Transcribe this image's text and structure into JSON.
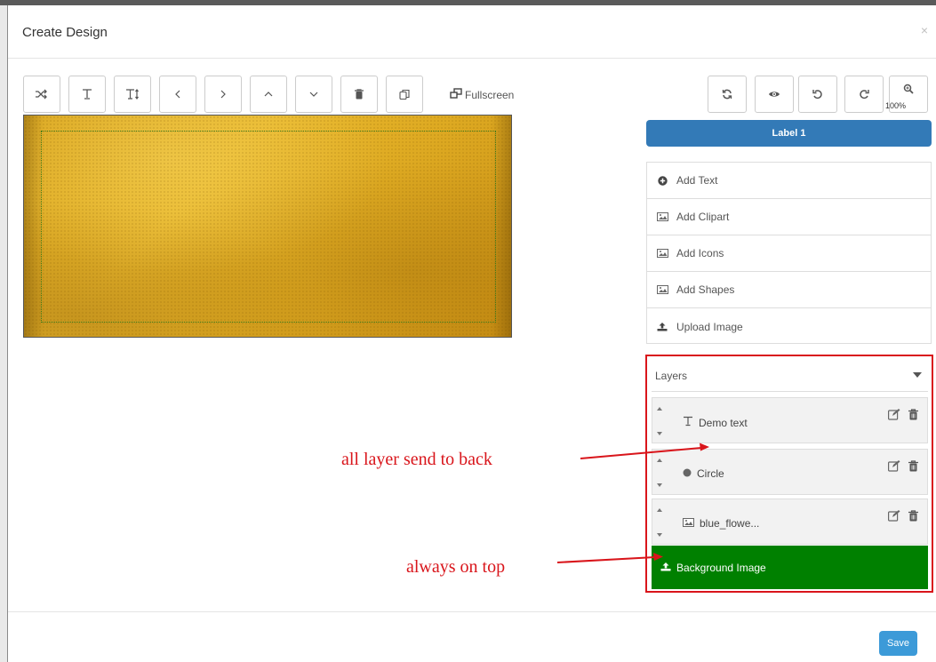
{
  "modal": {
    "title": "Create Design",
    "close_glyph": "×"
  },
  "toolbar": {
    "left_tools": [
      {
        "icon": "shuffle-icon"
      },
      {
        "icon": "text-icon"
      },
      {
        "icon": "text-height-icon"
      },
      {
        "icon": "chevron-left-icon"
      },
      {
        "icon": "chevron-right-icon"
      },
      {
        "icon": "chevron-up-icon"
      },
      {
        "icon": "chevron-down-icon"
      },
      {
        "icon": "trash-icon"
      },
      {
        "icon": "duplicate-icon"
      }
    ],
    "fullscreen_label": "Fullscreen",
    "right_tools": [
      {
        "icon": "refresh-icon"
      },
      {
        "icon": "eye-icon"
      },
      {
        "icon": "undo-icon"
      },
      {
        "icon": "redo-icon"
      },
      {
        "icon": "zoom-icon"
      }
    ],
    "zoom_level": "100%"
  },
  "sidebar": {
    "label_tab": "Label 1",
    "add_items": [
      {
        "label": "Add Text",
        "icon": "plus-circle-icon"
      },
      {
        "label": "Add Clipart",
        "icon": "picture-icon"
      },
      {
        "label": "Add Icons",
        "icon": "picture-icon"
      },
      {
        "label": "Add Shapes",
        "icon": "picture-icon"
      },
      {
        "label": "Upload Image",
        "icon": "upload-icon"
      }
    ],
    "layers": {
      "title": "Layers",
      "items": [
        {
          "name": "Demo text",
          "icon": "text-icon"
        },
        {
          "name": "Circle",
          "icon": "circle-icon"
        },
        {
          "name": "blue_flowe...",
          "icon": "picture-icon"
        }
      ],
      "background_label": "Background Image"
    }
  },
  "annotations": {
    "send_to_back": "all layer send to back",
    "always_on_top": "always on top",
    "color": "#d9151b"
  },
  "footer": {
    "save_label": "Save"
  },
  "colors": {
    "primary": "#337ab7",
    "save": "#3c9ad8",
    "background_layer": "#008000",
    "highlight_border": "#d9151b"
  }
}
